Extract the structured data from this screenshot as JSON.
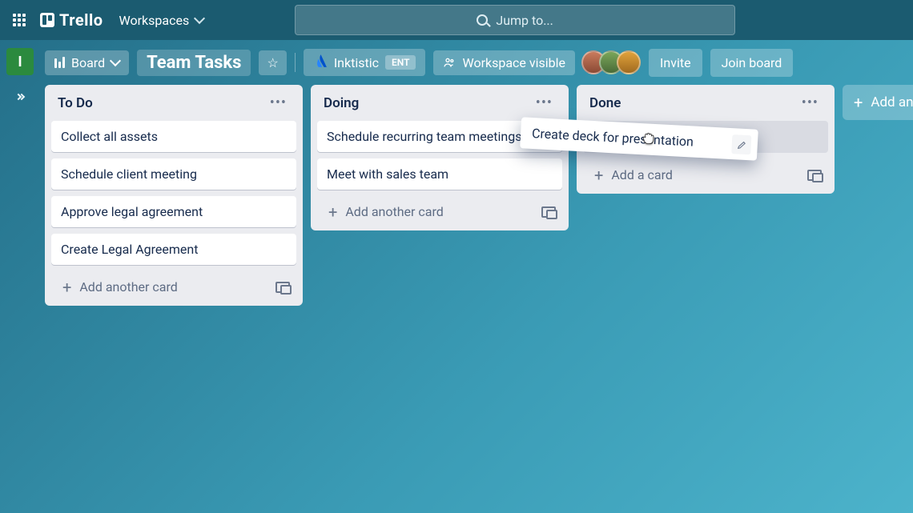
{
  "topbar": {
    "logo_text": "Trello",
    "workspaces_label": "Workspaces",
    "search_placeholder": "Jump to..."
  },
  "sidebar": {
    "workspace_initial": "I"
  },
  "board_header": {
    "view_label": "Board",
    "board_name": "Team Tasks",
    "org_name": "Inktistic",
    "org_badge": "ENT",
    "visibility_label": "Workspace visible",
    "invite_label": "Invite",
    "join_label": "Join board"
  },
  "lists": [
    {
      "title": "To Do",
      "cards": [
        "Collect all assets",
        "Schedule client meeting",
        "Approve legal agreement",
        "Create Legal Agreement"
      ],
      "add_label": "Add another card"
    },
    {
      "title": "Doing",
      "cards": [
        "Schedule recurring team meetings",
        "Meet with sales team"
      ],
      "add_label": "Add another card"
    },
    {
      "title": "Done",
      "cards": [],
      "placeholder": true,
      "add_label": "Add a card"
    }
  ],
  "dragging_card": {
    "text": "Create deck for presentation"
  },
  "add_list_label": "Add another list"
}
